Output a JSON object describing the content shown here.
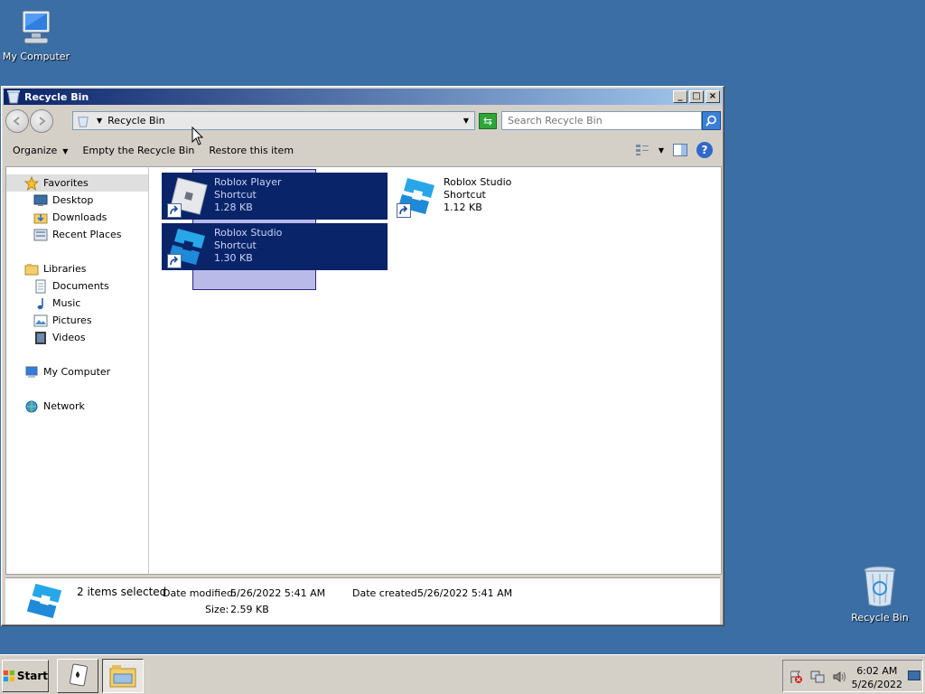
{
  "desktop": {
    "icons": [
      {
        "label": "My Computer"
      },
      {
        "label": "Recycle Bin"
      }
    ]
  },
  "window": {
    "title": "Recycle Bin",
    "controls": {
      "minimize": "_",
      "maximize": "□",
      "close": "×"
    },
    "address": {
      "path": "Recycle Bin"
    },
    "search": {
      "placeholder": "Search Recycle Bin"
    },
    "commands": {
      "organize": "Organize",
      "empty": "Empty the Recycle Bin",
      "restore": "Restore this item"
    },
    "help": "?",
    "nav": {
      "favorites": "Favorites",
      "desktop": "Desktop",
      "downloads": "Downloads",
      "recent": "Recent Places",
      "libraries": "Libraries",
      "documents": "Documents",
      "music": "Music",
      "pictures": "Pictures",
      "videos": "Videos",
      "computer": "My Computer",
      "network": "Network"
    },
    "files": [
      {
        "name": "Roblox Player",
        "type": "Shortcut",
        "size": "1.28 KB",
        "selected": true
      },
      {
        "name": "Roblox Studio",
        "type": "Shortcut",
        "size": "1.12 KB",
        "selected": false
      },
      {
        "name": "Roblox Studio",
        "type": "Shortcut",
        "size": "1.30 KB",
        "selected": true
      }
    ],
    "details": {
      "count": "2 items selected",
      "modified_label": "Date modified:",
      "modified_value": "5/26/2022 5:41 AM",
      "created_label": "Date created:",
      "created_value": "5/26/2022 5:41 AM",
      "size_label": "Size:",
      "size_value": "2.59 KB"
    }
  },
  "taskbar": {
    "start": "Start",
    "time": "6:02 AM",
    "date": "5/26/2022"
  },
  "colors": {
    "desktop": "#3a6ea5",
    "title_start": "#0a246a",
    "title_end": "#a6caf0",
    "selection": "#0a246a"
  }
}
